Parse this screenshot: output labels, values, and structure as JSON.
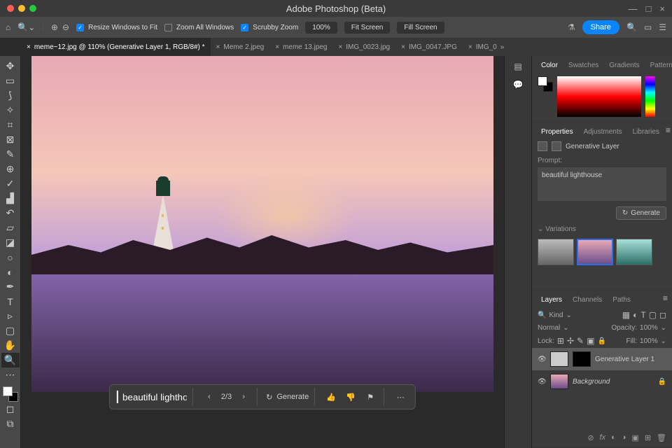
{
  "app": {
    "title": "Adobe Photoshop (Beta)"
  },
  "toolbar": {
    "resize_label": "Resize Windows to Fit",
    "zoom_all": "Zoom All Windows",
    "scrubby": "Scrubby Zoom",
    "zoom_pct": "100%",
    "fit": "Fit Screen",
    "fill": "Fill Screen",
    "share": "Share"
  },
  "tabs": [
    {
      "label": "meme~12.jpg @ 110% (Generative Layer 1, RGB/8#) *",
      "active": true
    },
    {
      "label": "Meme 2.jpeg"
    },
    {
      "label": "meme 13.jpeg"
    },
    {
      "label": "IMG_0023.jpg"
    },
    {
      "label": "IMG_0047.JPG"
    },
    {
      "label": "IMG_0"
    }
  ],
  "contextbar": {
    "prompt": "beautiful lighthouse",
    "counter": "2/3",
    "generate": "Generate"
  },
  "color_panel": {
    "tabs": [
      "Color",
      "Swatches",
      "Gradients",
      "Patterns"
    ],
    "active": "Color"
  },
  "props_panel": {
    "tabs": [
      "Properties",
      "Adjustments",
      "Libraries"
    ],
    "active": "Properties",
    "type": "Generative Layer",
    "prompt_label": "Prompt:",
    "prompt_value": "beautiful lighthouse",
    "generate": "Generate",
    "variations_label": "Variations"
  },
  "layers_panel": {
    "tabs": [
      "Layers",
      "Channels",
      "Paths"
    ],
    "active": "Layers",
    "kind": "Kind",
    "blend": "Normal",
    "opacity_label": "Opacity:",
    "opacity": "100%",
    "lock_label": "Lock:",
    "fill_label": "Fill:",
    "fill": "100%",
    "layers": [
      {
        "name": "Generative Layer 1",
        "selected": true,
        "mask": true
      },
      {
        "name": "Background",
        "locked": true
      }
    ]
  }
}
